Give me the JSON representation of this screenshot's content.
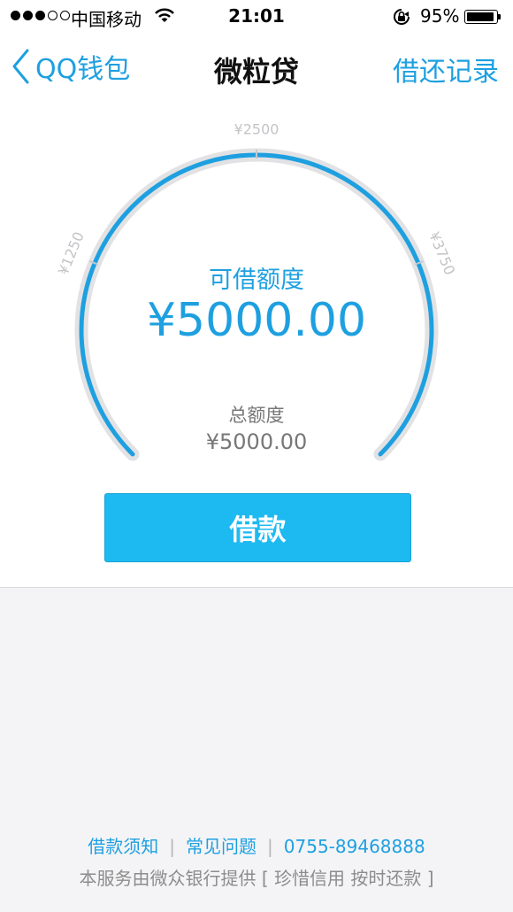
{
  "status_bar": {
    "carrier": "中国移动",
    "time": "21:01",
    "battery": "95%",
    "battery_level": 0.95,
    "signal_strength": 3,
    "signal_max": 5
  },
  "nav": {
    "back_label": "QQ钱包",
    "title": "微粒贷",
    "right_link": "借还记录"
  },
  "gauge": {
    "tick_labels": [
      "¥1250",
      "¥2500",
      "¥3750"
    ],
    "available_label": "可借额度",
    "available_amount": "¥5000.00",
    "total_label": "总额度",
    "total_amount": "¥5000.00",
    "fill_fraction": 1.0
  },
  "borrow_button": "借款",
  "footer": {
    "links": [
      "借款须知",
      "常见问题",
      "0755-89468888"
    ],
    "note": "本服务由微众银行提供 [ 珍惜信用 按时还款 ]"
  },
  "colors": {
    "accent": "#1ea0e0",
    "button": "#1dbaf1",
    "track": "#e2e2e4"
  }
}
